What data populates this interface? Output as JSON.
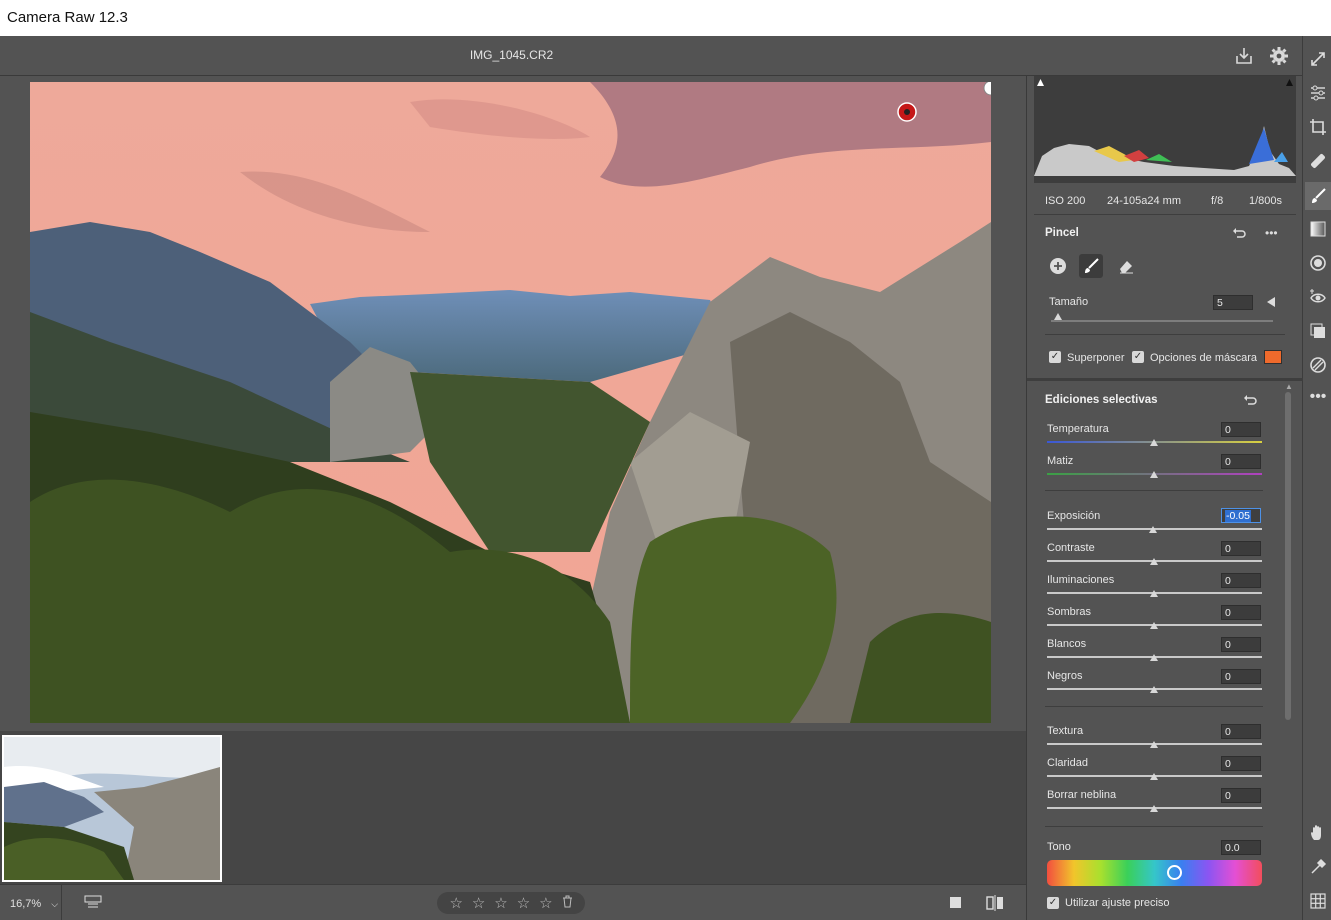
{
  "window": {
    "title": "Camera Raw 12.3"
  },
  "header": {
    "filename": "IMG_1045.CR2"
  },
  "toolbar": {
    "icons": [
      "save-icon",
      "gear-icon",
      "fullscreen-icon"
    ]
  },
  "tools": [
    "edit-icon",
    "crop-icon",
    "heal-icon",
    "brush-icon",
    "gradient-icon",
    "radial-icon",
    "redeye-icon",
    "snapshot-icon",
    "presets-icon",
    "more-icon",
    "hand-icon",
    "eyedropper-icon",
    "grid-icon"
  ],
  "meta": {
    "iso": "ISO 200",
    "lens": "24-105a24 mm",
    "aperture": "f/8",
    "shutter": "1/800s"
  },
  "brush_panel": {
    "title": "Pincel",
    "size_label": "Tamaño",
    "size_value": "5",
    "overlay_label": "Superponer",
    "mask_options_label": "Opciones de máscara",
    "mask_color": "#ef6a2c"
  },
  "selective": {
    "title": "Ediciones selectivas",
    "temperature": {
      "label": "Temperatura",
      "value": "0"
    },
    "tint": {
      "label": "Matiz",
      "value": "0"
    },
    "exposure": {
      "label": "Exposición",
      "value": "-0.05"
    },
    "contrast": {
      "label": "Contraste",
      "value": "0"
    },
    "highlights": {
      "label": "Iluminaciones",
      "value": "0"
    },
    "shadows": {
      "label": "Sombras",
      "value": "0"
    },
    "whites": {
      "label": "Blancos",
      "value": "0"
    },
    "blacks": {
      "label": "Negros",
      "value": "0"
    },
    "texture": {
      "label": "Textura",
      "value": "0"
    },
    "clarity": {
      "label": "Claridad",
      "value": "0"
    },
    "dehaze": {
      "label": "Borrar neblina",
      "value": "0"
    },
    "hue": {
      "label": "Tono",
      "value": "0.0"
    },
    "fine_adjust_label": "Utilizar ajuste preciso"
  },
  "bottom": {
    "zoom": "16,7%",
    "stars": [
      "☆",
      "☆",
      "☆",
      "☆",
      "☆"
    ]
  }
}
